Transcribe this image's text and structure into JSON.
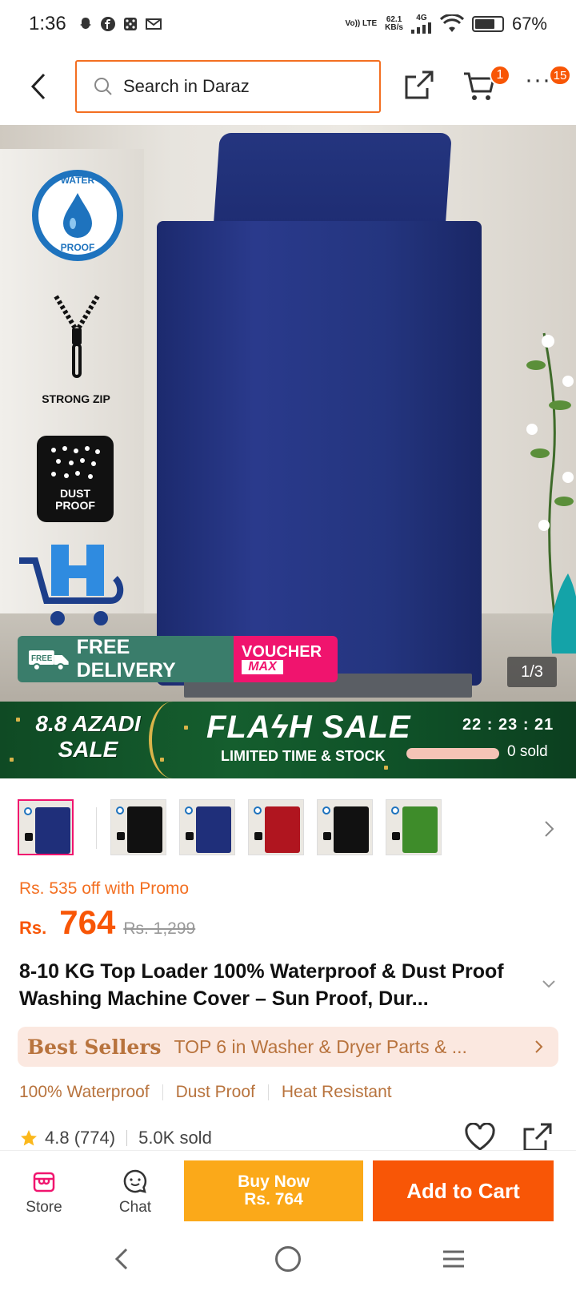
{
  "status_bar": {
    "time": "1:36",
    "volte": "Vo)) LTE",
    "speed_value": "62.1",
    "speed_unit": "KB/s",
    "network": "4G",
    "battery": "67%"
  },
  "header": {
    "search_placeholder": "Search in Daraz",
    "cart_count": "1",
    "more_count": "15"
  },
  "gallery": {
    "badges": {
      "water_top": "WATER",
      "water_bottom": "PROOF",
      "zip_label": "STRONG ZIP",
      "dust_line1": "DUST",
      "dust_line2": "PROOF"
    },
    "delivery_free_tag": "FREE",
    "delivery_label": "FREE DELIVERY",
    "voucher_line1": "VOUCHER",
    "voucher_line2": "MAX",
    "counter": "1/3",
    "thumbnail_colors": [
      "#1f2f7a",
      "#111111",
      "#1f2f7a",
      "#b0151f",
      "#111111",
      "#3e8c2a"
    ]
  },
  "flash_sale": {
    "event_line1": "8.8 AZADI",
    "event_line2": "SALE",
    "title": "FLAϟH SALE",
    "subtitle": "LIMITED TIME & STOCK",
    "timer": "22 : 23 : 21",
    "sold": "0 sold"
  },
  "pricing": {
    "promo_text": "Rs. 535 off with Promo",
    "currency": "Rs.",
    "price": "764",
    "original_price": "Rs. 1,299"
  },
  "product": {
    "title": "8-10 KG Top Loader 100% Waterproof & Dust Proof Washing Machine Cover – Sun Proof, Dur..."
  },
  "best_sellers": {
    "badge": "Best Sellers",
    "text": "TOP 6 in Washer & Dryer Parts & ..."
  },
  "tags": [
    "100% Waterproof",
    "Dust Proof",
    "Heat Resistant"
  ],
  "rating": {
    "score": "4.8",
    "count": "(774)",
    "sold": "5.0K sold"
  },
  "actions": {
    "store_label": "Store",
    "chat_label": "Chat",
    "buy_now_line1": "Buy Now",
    "buy_now_line2": "Rs. 764",
    "add_to_cart": "Add to Cart"
  },
  "colors": {
    "brand_orange": "#f85606",
    "buy_now_yellow": "#fba919",
    "accent_tan": "#b8733d",
    "flash_green": "#155e2e"
  }
}
